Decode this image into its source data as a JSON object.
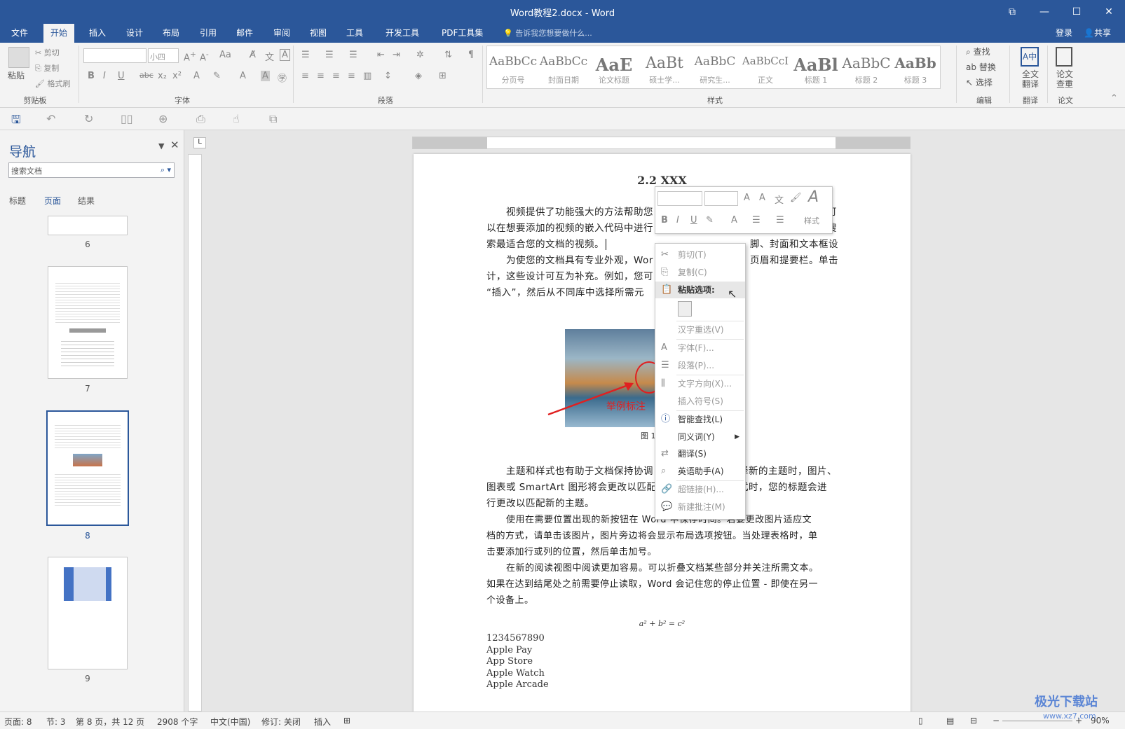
{
  "window": {
    "title": "Word教程2.docx - Word"
  },
  "tabs": [
    "文件",
    "开始",
    "插入",
    "设计",
    "布局",
    "引用",
    "邮件",
    "审阅",
    "视图",
    "工具",
    "开发工具",
    "PDF工具集"
  ],
  "tell_me": "告诉我您想要做什么...",
  "account": {
    "login": "登录",
    "share": "共享"
  },
  "ribbon": {
    "clipboard": {
      "paste": "粘贴",
      "cut": "剪切",
      "copy": "复制",
      "format_painter": "格式刷",
      "label": "剪贴板"
    },
    "font": {
      "size": "小四",
      "label": "字体"
    },
    "paragraph": {
      "label": "段落"
    },
    "styles": {
      "label": "样式",
      "items": [
        {
          "sample": "AaBbCc",
          "name": "分页号"
        },
        {
          "sample": "AaBbCc",
          "name": "封面日期"
        },
        {
          "sample": "AaE",
          "name": "论文标题"
        },
        {
          "sample": "AaBt",
          "name": "硕士学..."
        },
        {
          "sample": "AaBbC",
          "name": "研究生..."
        },
        {
          "sample": "AaBbCcI",
          "name": "正文"
        },
        {
          "sample": "AaBl",
          "name": "标题 1"
        },
        {
          "sample": "AaBbC",
          "name": "标题 2"
        },
        {
          "sample": "AaBb",
          "name": "标题 3"
        }
      ]
    },
    "editing": {
      "find": "查找",
      "replace": "替换",
      "select": "选择",
      "label": "编辑"
    },
    "translate": {
      "full": "全文翻译",
      "label": "翻译"
    },
    "thesis": {
      "check": "论文查重",
      "label": "论文"
    }
  },
  "nav": {
    "title": "导航",
    "search_placeholder": "搜索文档",
    "tabs": [
      "标题",
      "页面",
      "结果"
    ],
    "pages": [
      "6",
      "7",
      "8",
      "9"
    ]
  },
  "document": {
    "heading": "2.2 XXX",
    "p1": "视频提供了功能强大的方法帮助您证明您的观点。当您单击联机视频时，可以在想要添加的视频的嵌入代码中进行粘贴。您也可以键入一个关键字以联机搜索最适合您的文档的视频。",
    "p1_l1": "视频提供了功能强大的方法帮助您",
    "p1_l1b": "可",
    "p1_l2": "以在想要添加的视频的嵌入代码中进行",
    "p1_l2b": "搜",
    "p1_l3": "索最适合您的文档的视频。",
    "p2_l1": "为使您的文档具有专业外观，Wor",
    "p2_l1b": "脚、封面和文本框设",
    "p2_l2": "计，这些设计可互为补充。例如，您可",
    "p2_l2b": "页眉和提要栏。单击",
    "p2_l3": "“插入”，然后从不同库中选择所需元",
    "caption_prefix": "图 1",
    "annotation": "举例标注",
    "p3_l1": "主题和样式也有助于文档保持协调",
    "p3_l1b": "择新的主题时，图片、",
    "p3_l2": "图表或 SmartArt 图形将会更改以匹配",
    "p3_l2b": "式时，您的标题会进",
    "p3_l3": "行更改以匹配新的主题。",
    "p4_l1": "使用在需要位置出现的新按钮在 Word 中保存时间。若要更改图片适应文",
    "p4_l2": "档的方式，请单击该图片，图片旁边将会显示布局选项按钮。当处理表格时，单",
    "p4_l3": "击要添加行或列的位置，然后单击加号。",
    "p5_l1": "在新的阅读视图中阅读更加容易。可以折叠文档某些部分并关注所需文本。",
    "p5_l2": "如果在达到结尾处之前需要停止读取，Word 会记住您的停止位置 - 即使在另一",
    "p5_l3": "个设备上。",
    "equation": "a² + b² = c²",
    "list": [
      "1234567890",
      "Apple Pay",
      "App Store",
      "Apple Watch",
      "Apple Arcade"
    ]
  },
  "mini_toolbar": {
    "style_label": "样式"
  },
  "context_menu": {
    "cut": "剪切(T)",
    "copy": "复制(C)",
    "paste_options": "粘贴选项:",
    "reconvert": "汉字重选(V)",
    "font": "字体(F)...",
    "paragraph": "段落(P)...",
    "text_direction": "文字方向(X)...",
    "insert_symbol": "插入符号(S)",
    "smart_lookup": "智能查找(L)",
    "synonyms": "同义词(Y)",
    "translate": "翻译(S)",
    "english_assistant": "英语助手(A)",
    "hyperlink": "超链接(H)...",
    "new_comment": "新建批注(M)"
  },
  "status": {
    "page": "页面: 8",
    "section": "节: 3",
    "page_of": "第 8 页，共 12 页",
    "words": "2908 个字",
    "language": "中文(中国)",
    "track": "修订: 关闭",
    "insert_mode": "插入",
    "zoom": "90%"
  },
  "watermark": "极光下载站",
  "watermark_url": "www.xz7.com",
  "colors": {
    "brand": "#2b579a",
    "annotation": "#e02020"
  }
}
